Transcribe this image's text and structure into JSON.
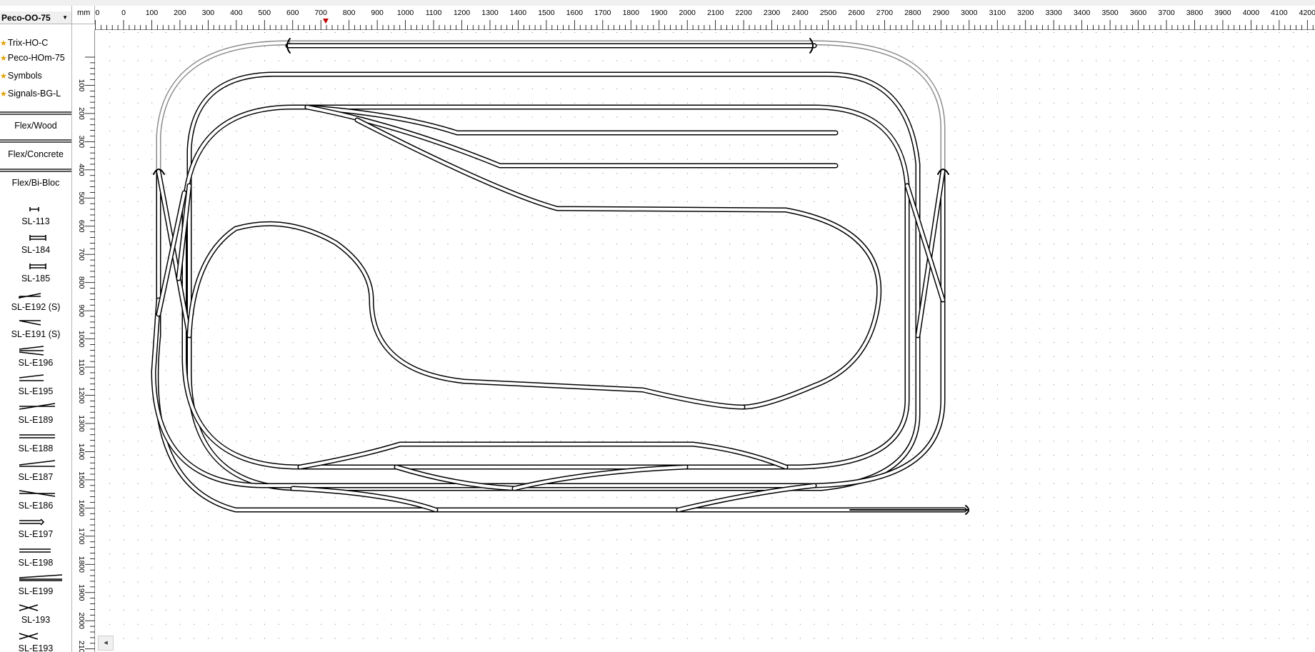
{
  "toolbar": {
    "icons": [
      "new-icon",
      "open-icon",
      "save-icon",
      "print-icon",
      "print-preview-icon",
      "undo-icon",
      "redo-icon",
      "cut-icon",
      "copy-icon",
      "paste-icon",
      "delete-icon",
      "select-icon",
      "zoom-in-icon",
      "zoom-out-icon",
      "zoom-fit-icon",
      "layer-icon",
      "track-tool-icon",
      "connect-icon",
      "measure-icon",
      "3d-view-icon",
      "help-icon"
    ]
  },
  "sidebar": {
    "library_name": "Peco-OO-75",
    "favorites": [
      "Trix-HO-C",
      "Peco-HOm-75",
      "Symbols",
      "Signals-BG-L"
    ],
    "categories": [
      "Flex/Wood",
      "Flex/Concrete",
      "Flex/Bi-Bloc"
    ],
    "pieces": [
      "SL-113",
      "SL-184",
      "SL-185",
      "SL-E192 (S)",
      "SL-E191 (S)",
      "SL-E196",
      "SL-E195",
      "SL-E189",
      "SL-E188",
      "SL-E187",
      "SL-E186",
      "SL-E197",
      "SL-E198",
      "SL-E199",
      "SL-193",
      "SL-E193"
    ]
  },
  "ruler": {
    "unit": "mm",
    "marker_color": "#c00000"
  },
  "colors": {
    "track": "#000000",
    "track_gray": "#8c8c8c",
    "grid_dot": "#7a7a7a",
    "panel_bg": "#f0f0f0",
    "favorite_star": "#e0a000"
  },
  "scrollbar": {
    "left_arrow": "◂"
  }
}
